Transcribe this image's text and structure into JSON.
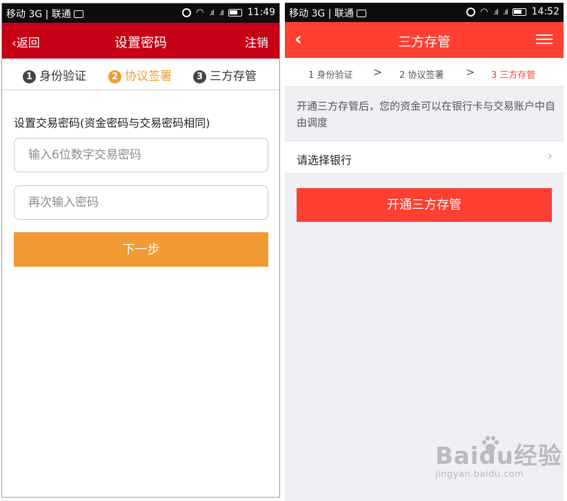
{
  "left": {
    "status": {
      "carrier": "移动 3G | 联通",
      "time": "11:49"
    },
    "nav": {
      "back": "返回",
      "title": "设置密码",
      "logout": "注销"
    },
    "steps": [
      {
        "num": "1",
        "label": "身份验证"
      },
      {
        "num": "2",
        "label": "协议签署"
      },
      {
        "num": "3",
        "label": "三方存管"
      }
    ],
    "active_step": 2,
    "form": {
      "label": "设置交易密码(资金密码与交易密码相同)",
      "password_placeholder": "输入6位数字交易密码",
      "confirm_placeholder": "再次输入密码",
      "next_button": "下一步"
    },
    "colors": {
      "nav": "#c60015",
      "accent": "#f29a34"
    }
  },
  "right": {
    "status": {
      "carrier": "移动 3G | 联通",
      "time": "14:52"
    },
    "nav": {
      "title": "三方存管"
    },
    "steps": [
      "1 身份验证",
      "2 协议签署",
      "3 三方存管"
    ],
    "step_separator": ">",
    "active_step": 3,
    "description": "开通三方存管后，您的资金可以在银行卡与交易账户中自由调度",
    "bank_select": "请选择银行",
    "open_button": "开通三方存管",
    "watermark": {
      "main": "Baidu经验",
      "sub": "jingyan.baidu.com"
    },
    "colors": {
      "nav": "#ff3f32",
      "background": "#efeff4"
    }
  },
  "icons": [
    "image-icon",
    "alarm-icon",
    "wifi-icon",
    "signal-icon",
    "battery-icon",
    "chevron-left-icon",
    "menu-icon",
    "chevron-right-icon",
    "paw-icon"
  ]
}
